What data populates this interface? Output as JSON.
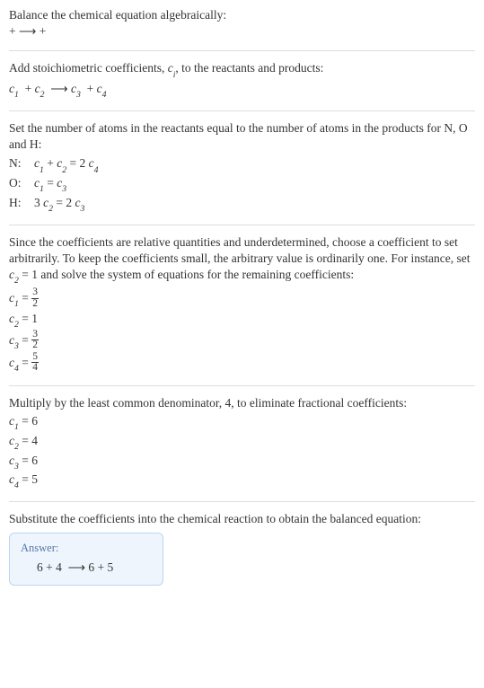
{
  "line1": "Balance the chemical equation algebraically:",
  "line2_pre": " + ",
  "line2_arrow": "⟶",
  "line2_post": " + ",
  "stoich_intro_a": "Add stoichiometric coefficients, ",
  "stoich_intro_c": "c",
  "stoich_intro_i": "i",
  "stoich_intro_b": ", to the reactants and products:",
  "stoich_eq": {
    "c1": "c",
    "s1": "1",
    "plus1": " + ",
    "c2": "c",
    "s2": "2",
    "arrow": "⟶",
    "c3": "c",
    "s3": "3",
    "plus2": " + ",
    "c4": "c",
    "s4": "4"
  },
  "atoms_intro": "Set the number of atoms in the reactants equal to the number of atoms in the products for N, O and H:",
  "atoms": {
    "n_label": "N:",
    "n_lhs_a": "c",
    "n_lhs_as": "1",
    "n_plus": " + ",
    "n_lhs_b": "c",
    "n_lhs_bs": "2",
    "n_eq": " = 2 ",
    "n_rhs": "c",
    "n_rhs_s": "4",
    "o_label": "O:",
    "o_lhs": "c",
    "o_lhs_s": "1",
    "o_eq": " = ",
    "o_rhs": "c",
    "o_rhs_s": "3",
    "h_label": "H:",
    "h_lhs_a": "3 ",
    "h_lhs": "c",
    "h_lhs_s": "2",
    "h_eq": " = 2 ",
    "h_rhs": "c",
    "h_rhs_s": "3"
  },
  "underdet_a": "Since the coefficients are relative quantities and underdetermined, choose a coefficient to set arbitrarily. To keep the coefficients small, the arbitrary value is ordinarily one. For instance, set ",
  "underdet_c": "c",
  "underdet_s": "2",
  "underdet_b": " = 1 and solve the system of equations for the remaining coefficients:",
  "frac_coeffs": {
    "c1_a": "c",
    "c1_s": "1",
    "c1_eq": " = ",
    "c1_num": "3",
    "c1_den": "2",
    "c2_a": "c",
    "c2_s": "2",
    "c2_eq": " = 1",
    "c3_a": "c",
    "c3_s": "3",
    "c3_eq": " = ",
    "c3_num": "3",
    "c3_den": "2",
    "c4_a": "c",
    "c4_s": "4",
    "c4_eq": " = ",
    "c4_num": "5",
    "c4_den": "4"
  },
  "lcd_intro": "Multiply by the least common denominator, 4, to eliminate fractional coefficients:",
  "int_coeffs": {
    "c1_a": "c",
    "c1_s": "1",
    "c1_v": " = 6",
    "c2_a": "c",
    "c2_s": "2",
    "c2_v": " = 4",
    "c3_a": "c",
    "c3_s": "3",
    "c3_v": " = 6",
    "c4_a": "c",
    "c4_s": "4",
    "c4_v": " = 5"
  },
  "sub_intro": "Substitute the coefficients into the chemical reaction to obtain the balanced equation:",
  "answer": {
    "title": "Answer:",
    "eq_a": "6 ",
    "eq_plus1": " + 4 ",
    "eq_arrow": "⟶",
    "eq_b": " 6 ",
    "eq_plus2": " + 5 "
  }
}
